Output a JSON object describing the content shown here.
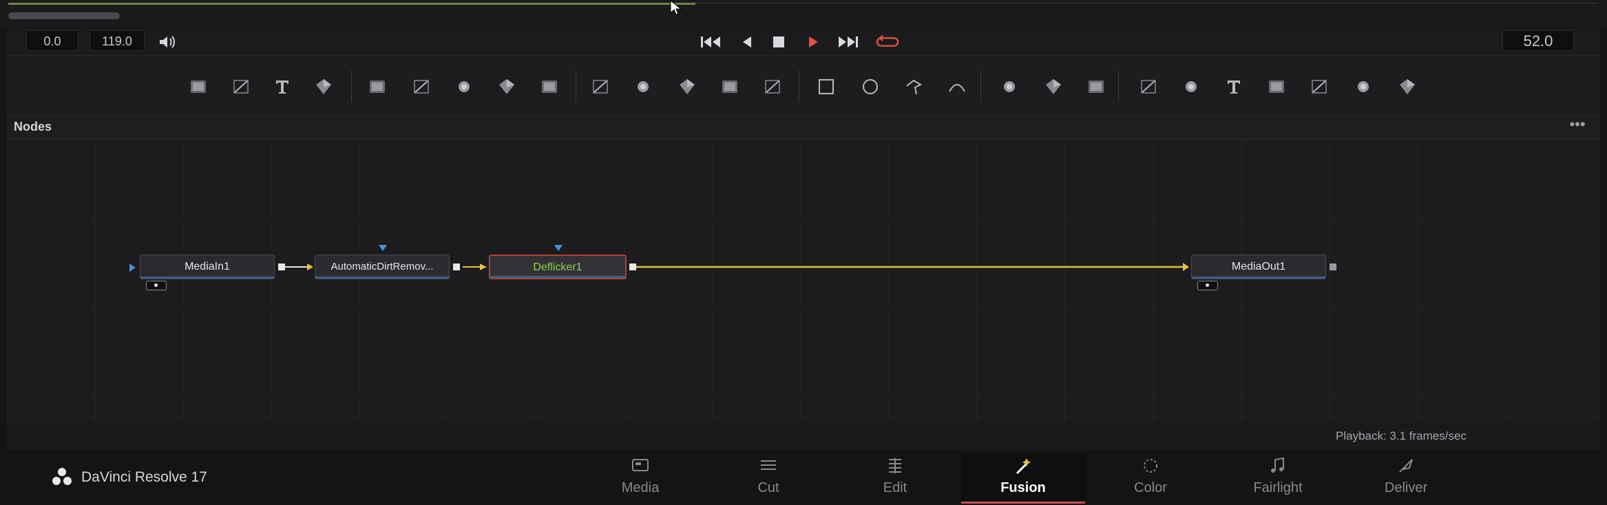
{
  "transport": {
    "start_time": "0.0",
    "end_time": "119.0",
    "current_frame": "52.0"
  },
  "toolbar_icons": [
    "background-icon",
    "fast-noise-icon",
    "text-icon",
    "paint-icon",
    "particles-icon",
    "color-curves-icon",
    "color-correct-icon",
    "brightness-contrast-icon",
    "blur-icon",
    "merge-icon",
    "channel-booleans-icon",
    "matte-control-icon",
    "resize-icon",
    "transform-icon",
    "rectangle-mask-icon",
    "ellipse-mask-icon",
    "polygon-mask-icon",
    "bspline-mask-icon",
    "particle-emitter-icon",
    "particle-render-icon",
    "particle-system-icon",
    "shape3d-icon",
    "merge3d-icon",
    "text3d-icon",
    "camera3d-icon",
    "renderer3d-icon",
    "image-plane-icon",
    "spot-light-icon"
  ],
  "nodes_panel": {
    "title": "Nodes",
    "menu": "•••"
  },
  "nodes": [
    {
      "label": "MediaIn1"
    },
    {
      "label": "AutomaticDirtRemov..."
    },
    {
      "label": "Deflicker1",
      "selected": true
    },
    {
      "label": "MediaOut1"
    }
  ],
  "status": {
    "playback": "Playback: 3.1 frames/sec"
  },
  "app": {
    "brand": "DaVinci Resolve 17"
  },
  "pages": [
    {
      "label": "Media",
      "icon": "media-page-icon"
    },
    {
      "label": "Cut",
      "icon": "cut-page-icon"
    },
    {
      "label": "Edit",
      "icon": "edit-page-icon"
    },
    {
      "label": "Fusion",
      "icon": "fusion-page-icon",
      "active": true
    },
    {
      "label": "Color",
      "icon": "color-page-icon"
    },
    {
      "label": "Fairlight",
      "icon": "fairlight-page-icon"
    },
    {
      "label": "Deliver",
      "icon": "deliver-page-icon"
    }
  ],
  "colors": {
    "accent_red": "#c8504a",
    "link_yellow": "#e8c23a",
    "port_blue": "#4a90d9",
    "selected_text_green": "#8fd24e"
  }
}
